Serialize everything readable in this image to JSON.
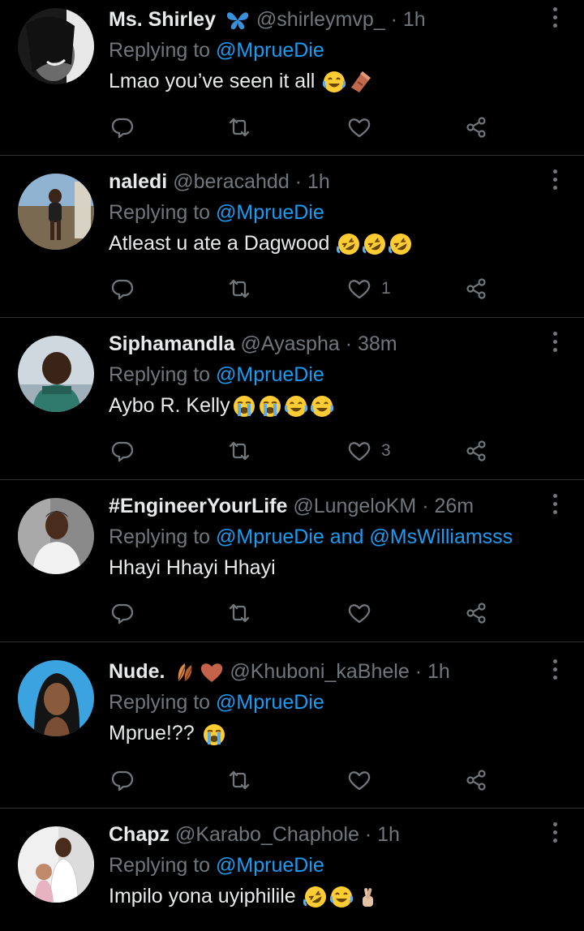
{
  "tweets": [
    {
      "name": "Ms. Shirley",
      "name_emoji": "butterfly",
      "handle": "@shirleymvp_",
      "dot": "·",
      "time": "1h",
      "replying_prefix": "Replying to",
      "mentions": [
        "@MprueDie"
      ],
      "mention_joiner": "",
      "text": "Lmao you’ve seen it all",
      "text_emojis": [
        "joy",
        "coffin"
      ],
      "likes": ""
    },
    {
      "name": "naledi",
      "handle": "@beracahdd",
      "dot": "·",
      "time": "1h",
      "replying_prefix": "Replying to",
      "mentions": [
        "@MprueDie"
      ],
      "mention_joiner": "",
      "text": "Atleast u ate a Dagwood",
      "text_emojis": [
        "rofl",
        "rofl",
        "rofl"
      ],
      "likes": "1"
    },
    {
      "name": "Siphamandla",
      "handle": "@Ayaspha",
      "dot": "·",
      "time": "38m",
      "replying_prefix": "Replying to",
      "mentions": [
        "@MprueDie"
      ],
      "mention_joiner": "",
      "text": "Aybo R. Kelly",
      "text_emojis": [
        "sob",
        "sob",
        "joy",
        "joy"
      ],
      "likes": "3"
    },
    {
      "name": "#EngineerYourLife",
      "handle": "@LungeloKM",
      "dot": "·",
      "time": "26m",
      "replying_prefix": "Replying to",
      "mentions": [
        "@MprueDie",
        "@MsWilliamsss"
      ],
      "mention_joiner": "and",
      "text": "Hhayi Hhayi Hhayi",
      "text_emojis": [],
      "likes": ""
    },
    {
      "name": "Nude.",
      "name_emoji": "leaves-heart",
      "handle": "@Khuboni_kaBhele",
      "dot": "·",
      "time": "1h",
      "replying_prefix": "Replying to",
      "mentions": [
        "@MprueDie"
      ],
      "mention_joiner": "",
      "text": "Mprue!??",
      "text_emojis": [
        "sob"
      ],
      "likes": ""
    },
    {
      "name": "Chapz",
      "handle": "@Karabo_Chaphole",
      "dot": "·",
      "time": "1h",
      "replying_prefix": "Replying to",
      "mentions": [
        "@MprueDie"
      ],
      "mention_joiner": "",
      "text": "Impilo yona uyiphilile",
      "text_emojis": [
        "rofl",
        "joy",
        "crossed-fingers"
      ],
      "likes": ""
    }
  ],
  "icons": {
    "reply": "reply-icon",
    "retweet": "retweet-icon",
    "like": "heart-icon",
    "share": "share-icon",
    "more": "more-icon"
  },
  "colors": {
    "background": "#000000",
    "text": "#e7e9ea",
    "muted": "#71767b",
    "accent": "#1d9bf0",
    "divider": "#2f3336"
  }
}
